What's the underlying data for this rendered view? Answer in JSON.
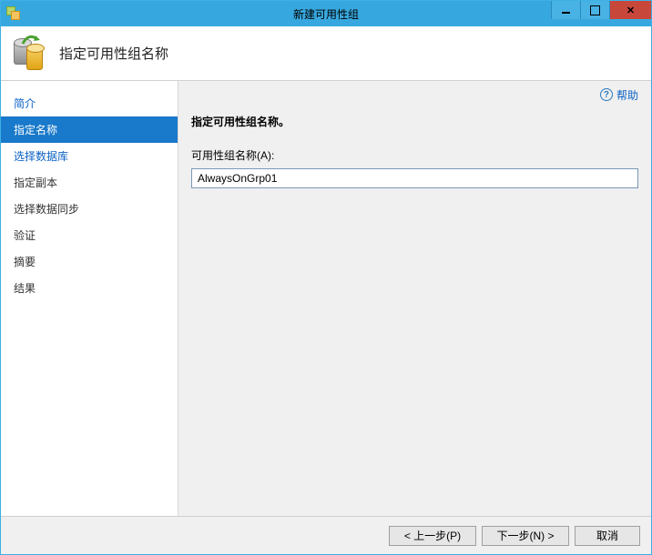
{
  "titlebar": {
    "title": "新建可用性组"
  },
  "header": {
    "title": "指定可用性组名称"
  },
  "help": {
    "label": "帮助"
  },
  "sidebar": {
    "items": [
      {
        "label": "简介",
        "link": true,
        "active": false
      },
      {
        "label": "指定名称",
        "link": false,
        "active": true
      },
      {
        "label": "选择数据库",
        "link": true,
        "active": false
      },
      {
        "label": "指定副本",
        "link": false,
        "active": false
      },
      {
        "label": "选择数据同步",
        "link": false,
        "active": false
      },
      {
        "label": "验证",
        "link": false,
        "active": false
      },
      {
        "label": "摘要",
        "link": false,
        "active": false
      },
      {
        "label": "结果",
        "link": false,
        "active": false
      }
    ]
  },
  "content": {
    "section_title": "指定可用性组名称。",
    "field_label": "可用性组名称(A):",
    "group_name_value": "AlwaysOnGrp01"
  },
  "footer": {
    "prev": "< 上一步(P)",
    "next": "下一步(N) >",
    "cancel": "取消"
  }
}
